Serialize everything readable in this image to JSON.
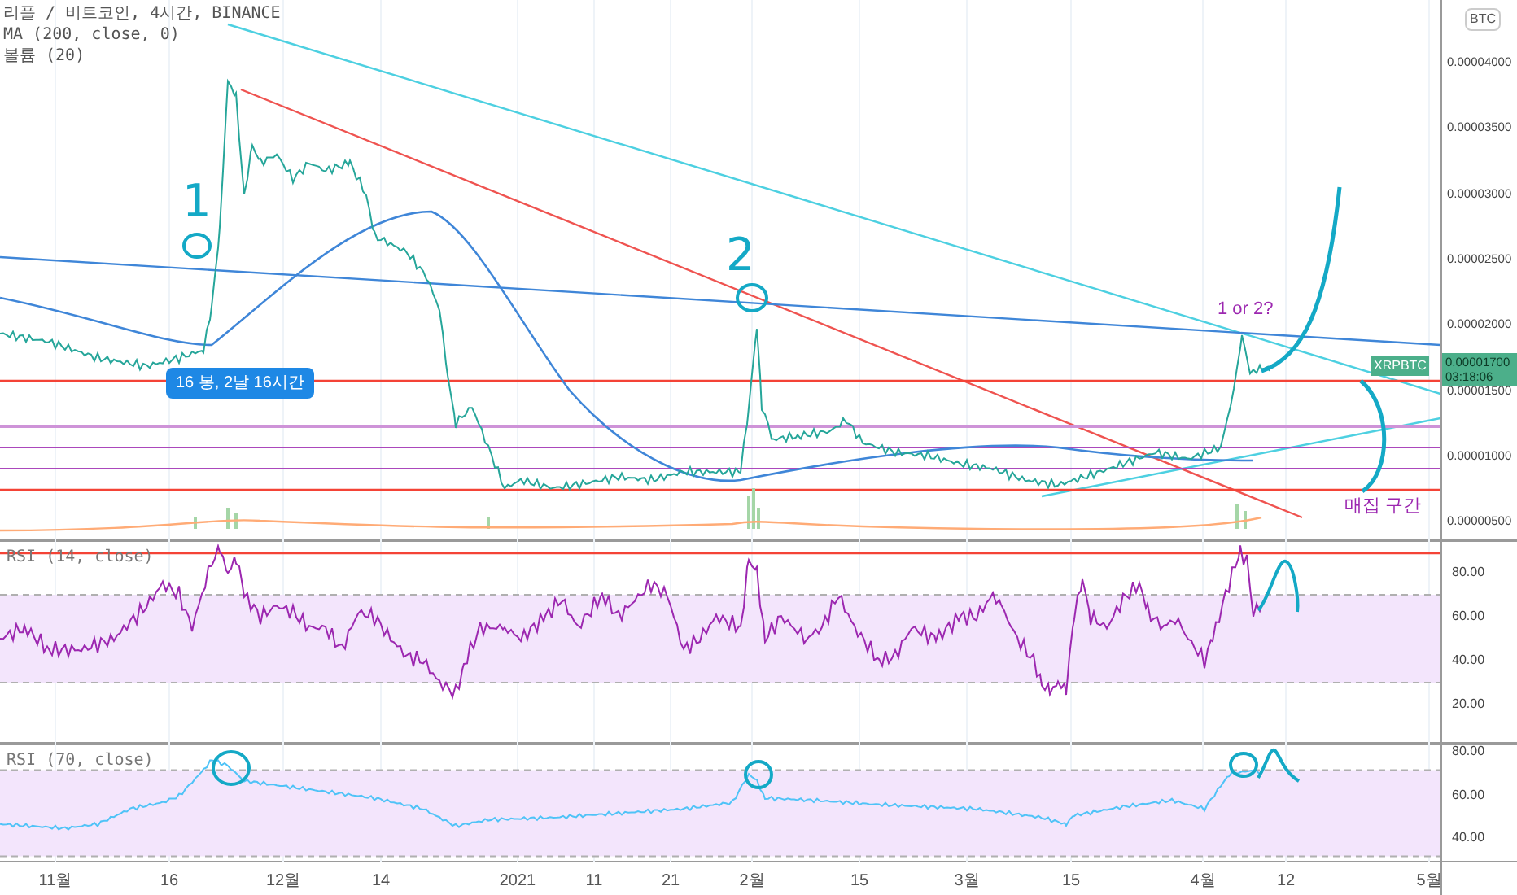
{
  "legend": {
    "title": "리플 / 비트코인, 4시간, BINANCE",
    "indicators": [
      "MA (200, close, 0)",
      "볼륨 (20)"
    ]
  },
  "currency_badge": "BTC",
  "price_axis": {
    "ticks": [
      "0.00004000",
      "0.00003500",
      "0.00003000",
      "0.00002500",
      "0.00002000",
      "0.00001500",
      "0.00001000",
      "0.00000500"
    ]
  },
  "price_tag": {
    "symbol": "XRPBTC",
    "price": "0.00001700",
    "countdown": "03:18:06"
  },
  "bar_count_badge": "16 봉, 2날 16시간",
  "annotations": [
    {
      "kind": "number",
      "text": "1"
    },
    {
      "kind": "number",
      "text": "2"
    },
    {
      "kind": "note",
      "text": "1 or 2?"
    },
    {
      "kind": "zone",
      "text": "매집 구간"
    }
  ],
  "rsi_panes": [
    {
      "legend": "RSI (14, close)",
      "ticks": [
        "80.00",
        "60.00",
        "40.00",
        "20.00"
      ]
    },
    {
      "legend": "RSI (70, close)",
      "ticks": [
        "80.00",
        "60.00",
        "40.00"
      ]
    }
  ],
  "time_axis": [
    "11월",
    "16",
    "12월",
    "14",
    "2021",
    "11",
    "21",
    "2월",
    "15",
    "3월",
    "15",
    "4월",
    "12",
    "5월"
  ]
}
